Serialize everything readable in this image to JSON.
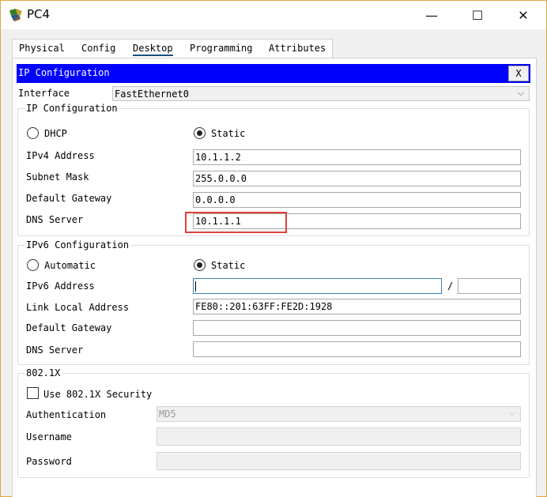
{
  "window": {
    "title": "PC4",
    "minimize": "—",
    "maximize": "☐",
    "close": "✕"
  },
  "tabs": [
    "Physical",
    "Config",
    "Desktop",
    "Programming",
    "Attributes"
  ],
  "dialog": {
    "title": "IP Configuration",
    "close": "X",
    "interface_label": "Interface",
    "interface_value": "FastEthernet0"
  },
  "ipv4": {
    "legend": "IP Configuration",
    "dhcp_label": "DHCP",
    "static_label": "Static",
    "mode": "Static",
    "address_label": "IPv4 Address",
    "address": "10.1.1.2",
    "mask_label": "Subnet Mask",
    "mask": "255.0.0.0",
    "gateway_label": "Default Gateway",
    "gateway": "0.0.0.0",
    "dns_label": "DNS Server",
    "dns": "10.1.1.1"
  },
  "ipv6": {
    "legend": "IPv6 Configuration",
    "auto_label": "Automatic",
    "static_label": "Static",
    "mode": "Static",
    "address_label": "IPv6 Address",
    "address": "",
    "slash": "/",
    "prefix": "",
    "link_local_label": "Link Local Address",
    "link_local": "FE80::201:63FF:FE2D:1928",
    "gateway_label": "Default Gateway",
    "gateway": "",
    "dns_label": "DNS Server",
    "dns": ""
  },
  "dot1x": {
    "legend": "802.1X",
    "use_label": "Use 802.1X Security",
    "use_checked": false,
    "auth_label": "Authentication",
    "auth_value": "MD5",
    "username_label": "Username",
    "username": "",
    "password_label": "Password",
    "password": ""
  },
  "colors": {
    "dialog_header": "#0000ff",
    "highlight": "#e0413a",
    "window_border": "#e3a63f"
  }
}
